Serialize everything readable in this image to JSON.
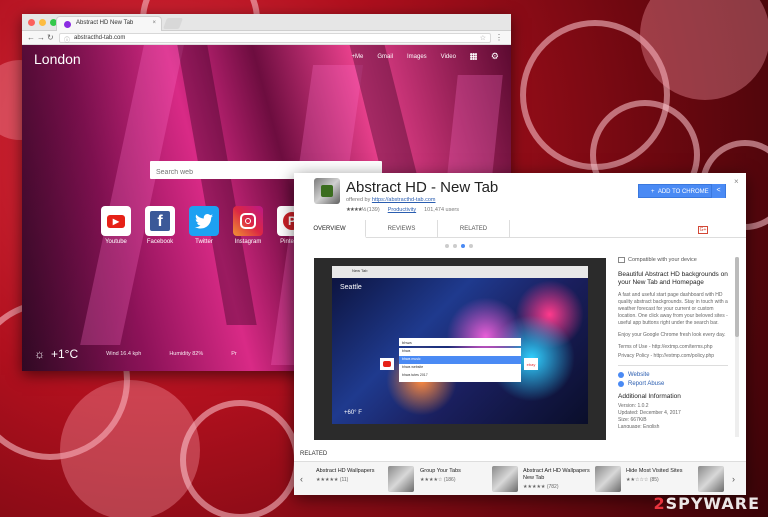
{
  "browser": {
    "tab_title": "Abstract HD New Tab",
    "url": "abstracthd-tab.com"
  },
  "newtab": {
    "city": "London",
    "top_links": [
      "+Me",
      "Gmail",
      "Images",
      "Video"
    ],
    "search_placeholder": "Search web",
    "tiles": [
      {
        "label": "Youtube",
        "icon": "youtube-icon",
        "color": "#e62117",
        "glyph": "▶"
      },
      {
        "label": "Facebook",
        "icon": "facebook-icon",
        "color": "#3b5998",
        "glyph": "f"
      },
      {
        "label": "Twitter",
        "icon": "twitter-icon",
        "color": "#1da1f2",
        "glyph": "t"
      },
      {
        "label": "Instagram",
        "icon": "instagram-icon",
        "color": "#c13584",
        "glyph": "◎"
      },
      {
        "label": "Pinterest",
        "icon": "pinterest-icon",
        "color": "#cb2027",
        "glyph": "P"
      }
    ],
    "weather": {
      "temp": "+1°C",
      "wind": "Wind 16.4 kph",
      "humidity": "Humidity 82%",
      "pressure": "Pr"
    }
  },
  "extension": {
    "title": "Abstract HD - New Tab",
    "offered_by_label": "offered by",
    "offered_by_link": "https://abstracthd-tab.com",
    "stars": "★★★★½",
    "rating_count": "(139)",
    "category": "Productivity",
    "users": "101,474 users",
    "add_button": "ADD TO CHROME",
    "tabs": [
      "OVERVIEW",
      "REVIEWS",
      "RELATED"
    ],
    "gplus": "G+",
    "screenshot": {
      "tab": "New Tab",
      "city": "Seattle",
      "temp": "+60° F",
      "search_text": "bhwa",
      "suggestions": [
        "bhwa",
        "bhwa music",
        "bhwa website",
        "bhwa tutes 2017"
      ],
      "ebay": "ebay"
    },
    "compatible": "Compatible with your device",
    "heading": "Beautiful Abstract HD backgrounds on your New Tab and Homepage",
    "para1": "A fast and useful start page dashboard with HD quality abstract backgrounds. Stay in touch with a weather forecast for your current or custom location. One click away from your beloved sites - useful app buttons right under the search bar.",
    "para2": "Enjoy your Google Chrome fresh look every day.",
    "terms": "Terms of Use - http://extmp.com/terms.php",
    "privacy": "Privacy Policy - http://extmp.com/policy.php",
    "website": "Website",
    "report_abuse": "Report Abuse",
    "additional_info": "Additional Information",
    "version": "Version: 1.0.2",
    "updated": "Updated: December 4, 2017",
    "size": "Size: 667KiB",
    "language": "Language: English",
    "related_heading": "RELATED",
    "related": [
      {
        "name": "Abstract HD Wallpapers",
        "stars": "★★★★★",
        "count": "(11)"
      },
      {
        "name": "Group Your Tabs",
        "stars": "★★★★☆",
        "count": "(186)"
      },
      {
        "name": "Abstract Art HD Wallpapers New Tab",
        "stars": "★★★★★",
        "count": "(782)"
      },
      {
        "name": "Hide Most Visited Sites",
        "stars": "★★☆☆☆",
        "count": "(85)"
      }
    ]
  },
  "watermark": {
    "part1": "2",
    "part2": "SPYWARE"
  }
}
